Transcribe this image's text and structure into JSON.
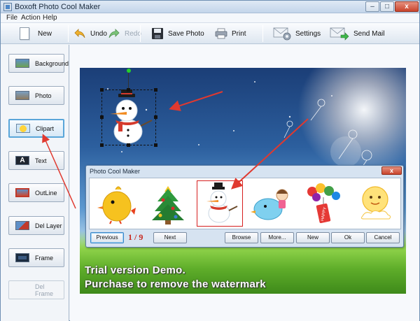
{
  "window": {
    "title": "Boxoft Photo Cool Maker"
  },
  "window_controls": {
    "minimize": "–",
    "maximize": "□",
    "close": "x"
  },
  "menu": [
    "File",
    "Action",
    "Help"
  ],
  "toolbar": {
    "new": "New",
    "undo": "Undo",
    "redo": "Redo",
    "save_photo": "Save Photo",
    "print": "Print",
    "settings": "Settings",
    "send_mail": "Send Mail"
  },
  "sidebar": {
    "items": [
      {
        "label": "Background"
      },
      {
        "label": "Photo"
      },
      {
        "label": "Clipart"
      },
      {
        "label": "Text"
      },
      {
        "label": "OutLine"
      },
      {
        "label": "Del Layer"
      },
      {
        "label": "Frame"
      },
      {
        "label": "Del Frame"
      }
    ],
    "active": "Clipart",
    "disabled": "Del Frame"
  },
  "canvas": {
    "watermark_line1": "Trial version Demo.",
    "watermark_line2": "Purchase to remove the watermark"
  },
  "dialog": {
    "title": "Photo Cool Maker",
    "close": "x",
    "page_indicator": "1 / 9",
    "cliparts": [
      "chick-icon",
      "christmas-tree-icon",
      "snowman-icon",
      "bird-girl-icon",
      "balloons-icon",
      "sun-icon"
    ],
    "selected_clipart": "snowman-icon",
    "buttons": {
      "previous": "Previous",
      "next": "Next",
      "browse": "Browse",
      "more": "More...",
      "new": "New",
      "ok": "Ok",
      "cancel": "Cancel"
    }
  },
  "colors": {
    "accent": "#5aa6d9",
    "annotation_arrow": "#e0392f",
    "selection": "#d61f1f"
  }
}
